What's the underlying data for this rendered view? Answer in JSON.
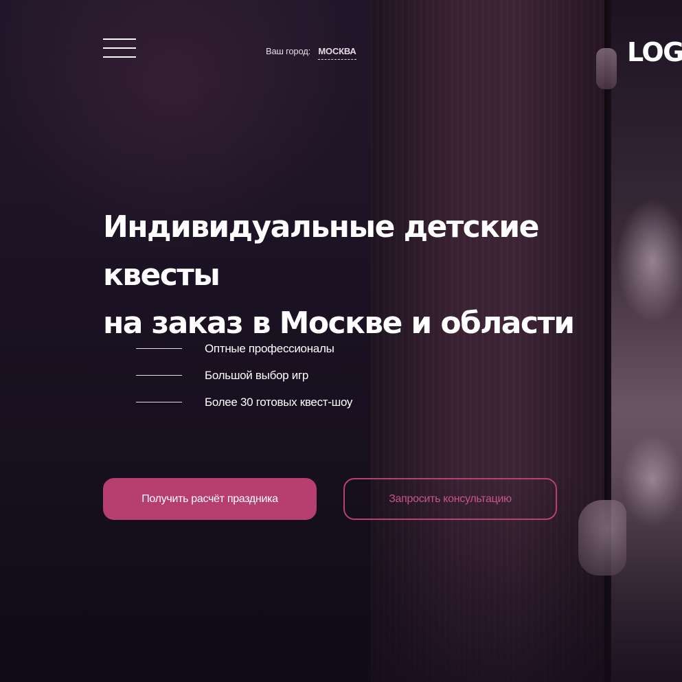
{
  "header": {
    "menu_icon": "hamburger-icon",
    "city_label": "Ваш город:",
    "city_value": "МОСКВА",
    "logo_text": "LOGO"
  },
  "hero": {
    "title_line1": "Индивидуальные детские квесты",
    "title_line2": "на заказ в Москве и области",
    "features": [
      {
        "label": "Оптные профессионалы"
      },
      {
        "label": "Большой выбор игр"
      },
      {
        "label": "Более 30 готовых квест-шоу"
      }
    ],
    "primary_button": "Получить расчёт праздника",
    "secondary_button": "Запросить консультацию"
  },
  "colors": {
    "accent": "#b73f6f",
    "accent_outline": "#b54272",
    "background": "#150e1c"
  }
}
